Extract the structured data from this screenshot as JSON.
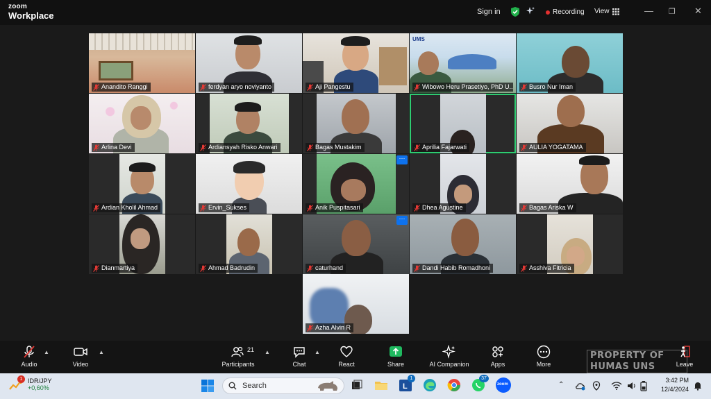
{
  "app": {
    "logo_line1": "zoom",
    "logo_line2": "Workplace"
  },
  "header": {
    "sign_in": "Sign in",
    "recording": "Recording",
    "view": "View"
  },
  "participants": [
    {
      "name": "Anandito Ranggi"
    },
    {
      "name": "ferdyan aryo noviyanto"
    },
    {
      "name": "Aji Pangestu"
    },
    {
      "name": "Wibowo Heru Prasetiyo, PhD U..."
    },
    {
      "name": "Busro Nur Iman"
    },
    {
      "name": "Arlina Devi"
    },
    {
      "name": "Ardiansyah Risko Anwari"
    },
    {
      "name": "Bagas Mustakim"
    },
    {
      "name": "Aprilia Fajarwati"
    },
    {
      "name": "AULIA YOGATAMA"
    },
    {
      "name": "Ardian Kholil Ahmad"
    },
    {
      "name": "Ervin_Sukses"
    },
    {
      "name": "Anik Puspitasari"
    },
    {
      "name": "Dhea Agustine"
    },
    {
      "name": "Bagas Ariska W"
    },
    {
      "name": "Dianmartiya"
    },
    {
      "name": "Ahmad Badrudin"
    },
    {
      "name": "caturhand"
    },
    {
      "name": "Dandi Habib Romadhoni"
    },
    {
      "name": "Asshiva Fitricia"
    },
    {
      "name": "Azha Alvin R"
    }
  ],
  "tile_labels": {
    "ums_logo": "UMS",
    "more": "···"
  },
  "toolbar": {
    "audio": "Audio",
    "video": "Video",
    "participants": "Participants",
    "participants_count": "21",
    "chat": "Chat",
    "react": "React",
    "share": "Share",
    "ai_companion": "AI Companion",
    "apps": "Apps",
    "more": "More",
    "leave": "Leave"
  },
  "watermark": {
    "line1": "PROPERTY OF",
    "line2": "HUMAS UNS"
  },
  "taskbar": {
    "ticker_name": "IDR/JPY",
    "ticker_change": "+0,60%",
    "ticker_badge": "1",
    "search_placeholder": "Search",
    "outlook_badge": "1",
    "whatsapp_badge": "37",
    "zoom_label": "zoom",
    "time": "3:42 PM",
    "date": "12/4/2024"
  },
  "colors": {
    "accent_blue": "#0e72ed",
    "share_green": "#1fb95f",
    "active_outline": "#2ecc71",
    "recording_red": "#e3302f"
  }
}
